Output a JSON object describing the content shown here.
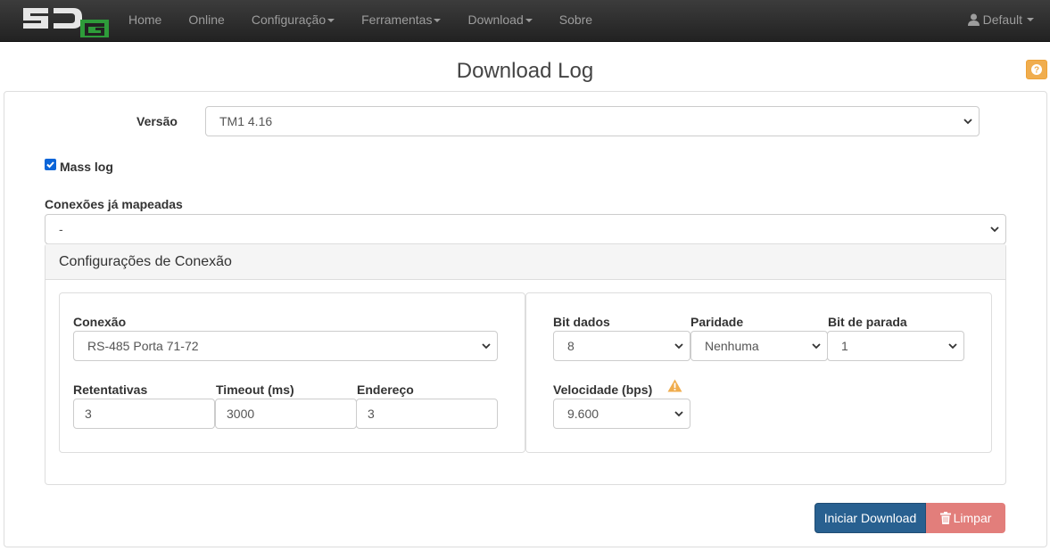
{
  "navbar": {
    "items": [
      {
        "label": "Home"
      },
      {
        "label": "Online"
      },
      {
        "label": "Configuração",
        "dropdown": true
      },
      {
        "label": "Ferramentas",
        "dropdown": true
      },
      {
        "label": "Download",
        "dropdown": true
      },
      {
        "label": "Sobre"
      }
    ],
    "user": "Default"
  },
  "page": {
    "title": "Download Log"
  },
  "form": {
    "versao_label": "Versão",
    "versao_value": "TM1 4.16",
    "mass_log_label": "Mass log",
    "mass_log_checked": true,
    "conexoes_label": "Conexões já mapeadas",
    "conexoes_value": "-"
  },
  "connection": {
    "heading": "Configurações de Conexão",
    "conexao_label": "Conexão",
    "conexao_value": "RS-485 Porta 71-72",
    "retentativas_label": "Retentativas",
    "retentativas_value": "3",
    "timeout_label": "Timeout (ms)",
    "timeout_value": "3000",
    "endereco_label": "Endereço",
    "endereco_value": "3",
    "bit_dados_label": "Bit dados",
    "bit_dados_value": "8",
    "paridade_label": "Paridade",
    "paridade_value": "Nenhuma",
    "bit_parada_label": "Bit de parada",
    "bit_parada_value": "1",
    "velocidade_label": "Velocidade (bps)",
    "velocidade_value": "9.600"
  },
  "actions": {
    "start_label": "Iniciar Download",
    "clear_label": "Limpar"
  },
  "colors": {
    "primary": "#286090",
    "danger": "#d9534f",
    "warning": "#f0ad4e",
    "logo_green": "#2e9c3a"
  }
}
